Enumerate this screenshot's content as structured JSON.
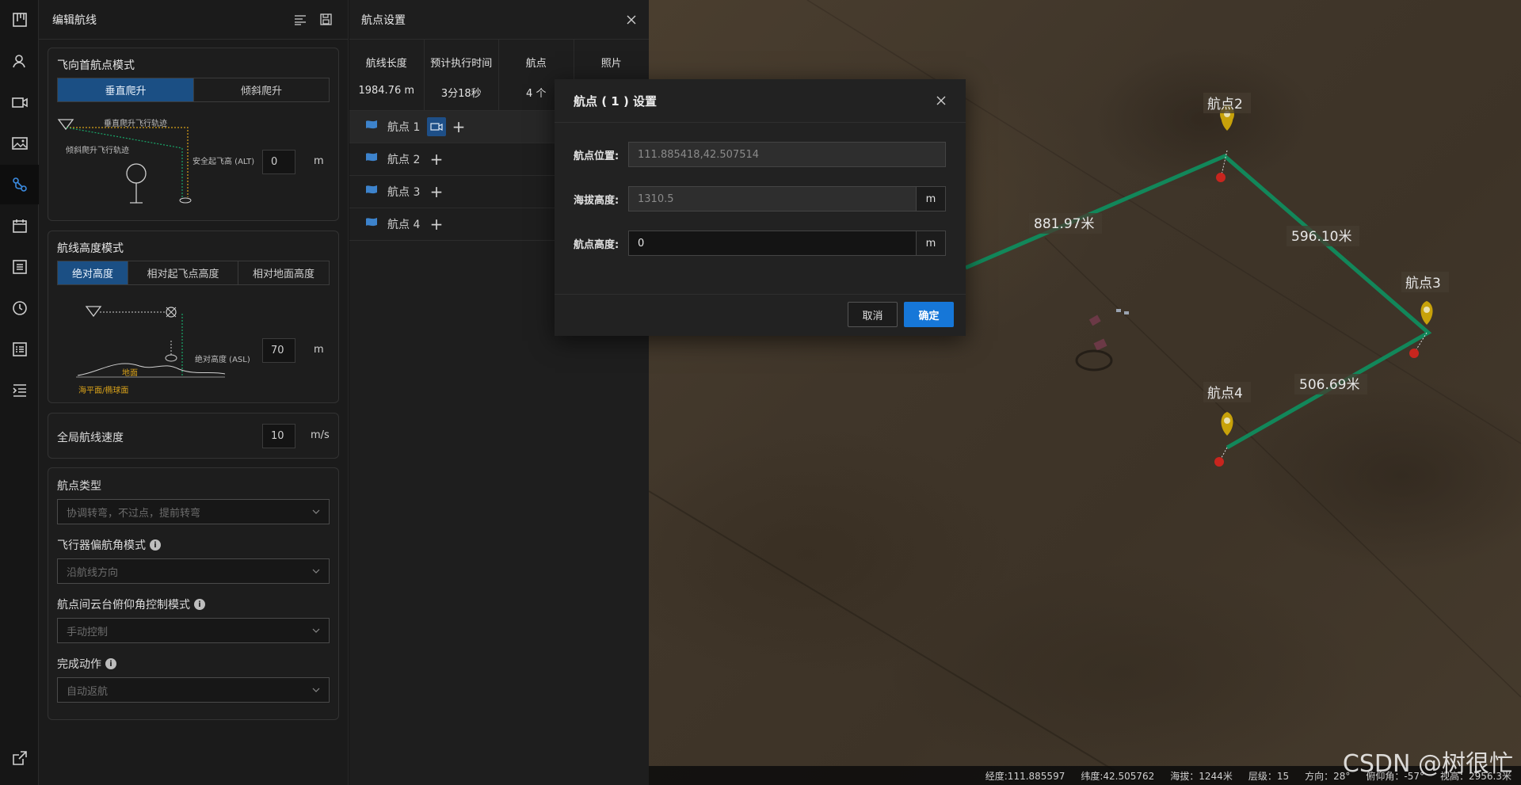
{
  "rail": [
    "board-icon",
    "user-icon",
    "video-icon",
    "image-icon",
    "route-icon",
    "calendar-icon",
    "list-icon",
    "history-icon",
    "checklist-icon",
    "indent-icon",
    "export-icon"
  ],
  "editor": {
    "title": "编辑航线",
    "first_point_mode": {
      "title": "飞向首航点模式",
      "options": [
        "垂直爬升",
        "倾斜爬升"
      ],
      "selected": "垂直爬升",
      "diagram": {
        "vertical_track": "垂直爬升飞行轨迹",
        "tilt_track": "倾斜爬升飞行轨迹",
        "safe_alt": "安全起飞高 (ALT)"
      },
      "alt_value": "0",
      "alt_unit": "m"
    },
    "height_mode": {
      "title": "航线高度模式",
      "options": [
        "绝对高度",
        "相对起飞点高度",
        "相对地面高度"
      ],
      "selected": "绝对高度",
      "diagram": {
        "asl": "绝对高度 (ASL)",
        "ground": "地面",
        "sea": "海平面/椭球面"
      },
      "value": "70",
      "unit": "m"
    },
    "speed": {
      "label": "全局航线速度",
      "value": "10",
      "unit": "m/s"
    },
    "waypoint_type": {
      "label": "航点类型",
      "value": "协调转弯，不过点，提前转弯"
    },
    "heading_mode": {
      "label": "飞行器偏航角模式",
      "value": "沿航线方向"
    },
    "gimbal_mode": {
      "label": "航点间云台俯仰角控制模式",
      "value": "手动控制"
    },
    "finish_action": {
      "label": "完成动作",
      "value": "自动返航"
    }
  },
  "wp_panel": {
    "title": "航点设置",
    "stats": [
      {
        "label": "航线长度",
        "value": "1984.76 m"
      },
      {
        "label": "预计执行时间",
        "value": "3分18秒"
      },
      {
        "label": "航点",
        "value": "4 个"
      },
      {
        "label": "照片",
        "value": ""
      }
    ],
    "waypoints": [
      "航点 1",
      "航点 2",
      "航点 3",
      "航点 4"
    ],
    "selected_index": 0
  },
  "map": {
    "markers": [
      "航点2",
      "航点3",
      "航点4"
    ],
    "distances": [
      "881.97米",
      "596.10米",
      "506.69米"
    ],
    "route_color": "#12875a",
    "status": {
      "lon": "经度:111.885597",
      "lat": "纬度:42.505762",
      "alt": "海拔：1244米",
      "level": "层级：15",
      "heading": "方向：28°",
      "pitch": "俯仰角：-57°",
      "view": "视高：2956.3米"
    },
    "watermark": "CSDN @树很忙"
  },
  "modal": {
    "title": "航点 ( 1 ) 设置",
    "position_label": "航点位置:",
    "position_value": "111.885418,42.507514",
    "asl_label": "海拔高度:",
    "asl_value": "1310.5",
    "asl_unit": "m",
    "height_label": "航点高度:",
    "height_value": "0",
    "height_unit": "m",
    "cancel": "取消",
    "ok": "确定"
  },
  "colors": {
    "accent": "#1677d8",
    "selected_segment": "#1b4f84",
    "marker_yellow": "#c8a20a"
  }
}
